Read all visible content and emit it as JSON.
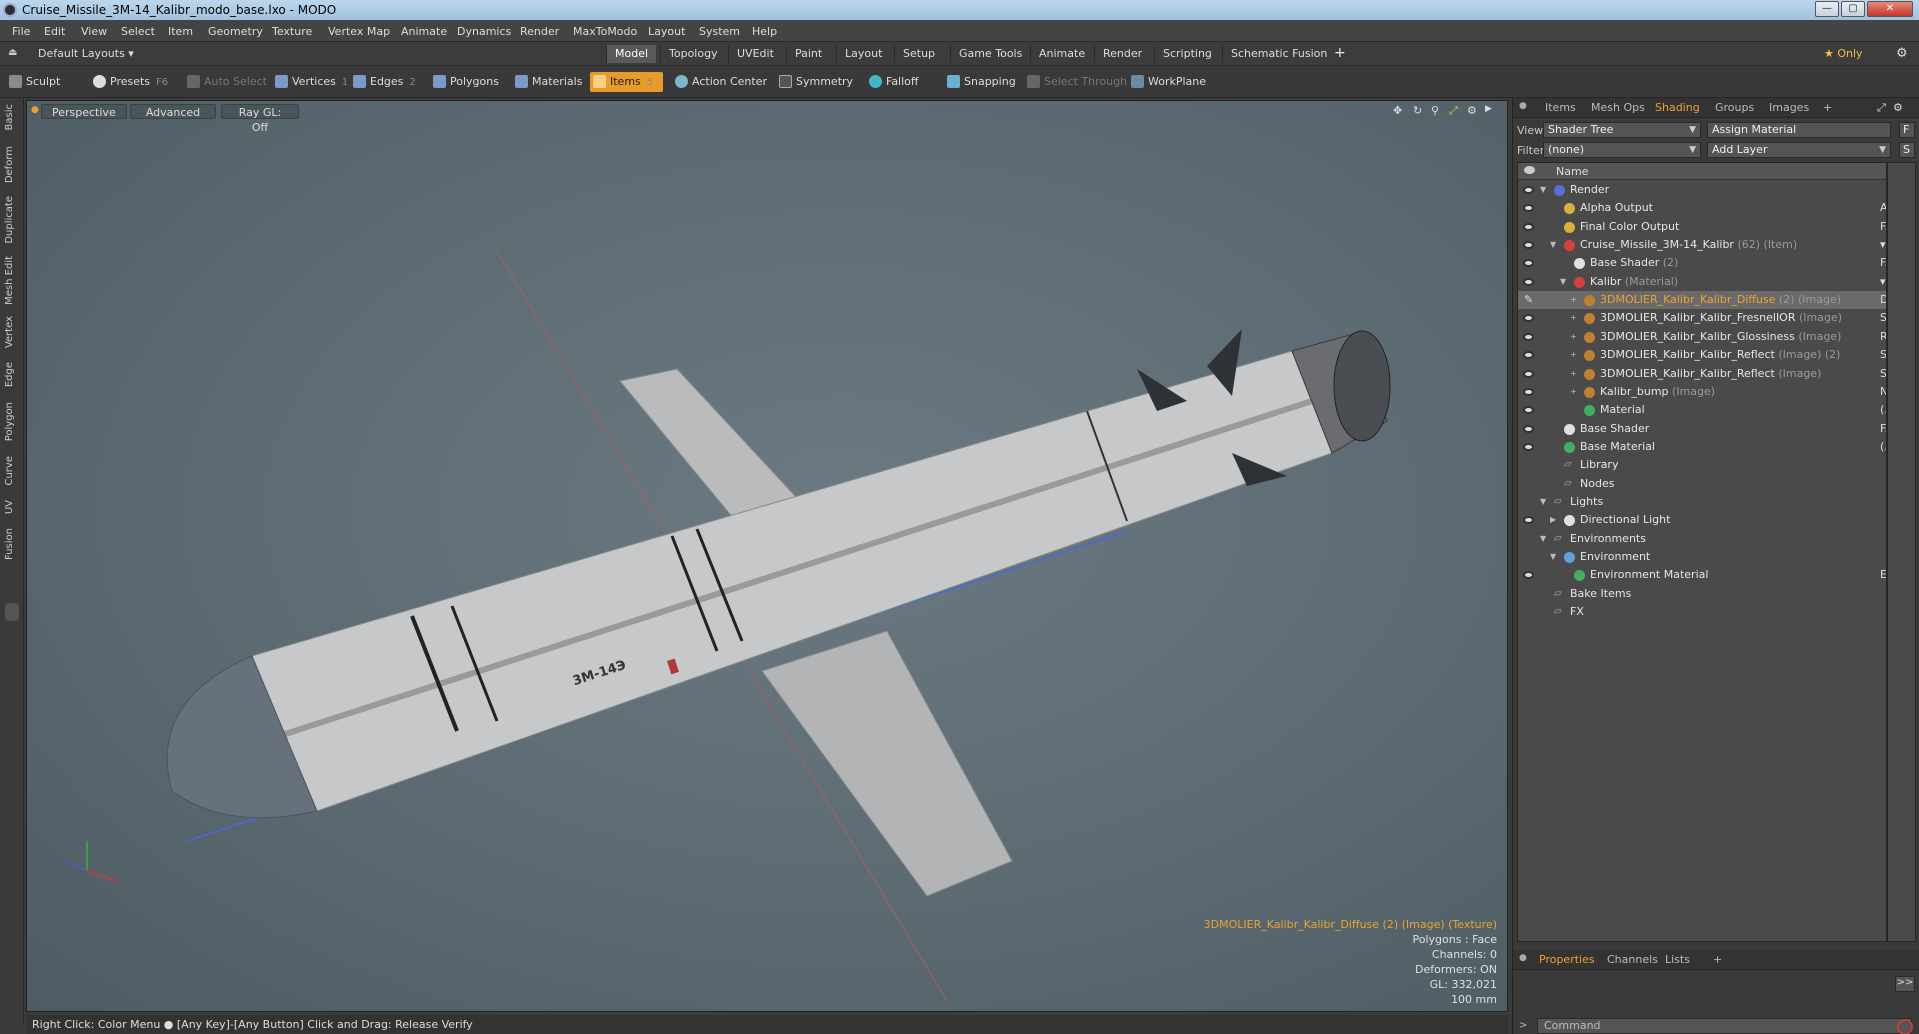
{
  "window": {
    "title": "Cruise_Missile_3M-14_Kalibr_modo_base.lxo - MODO",
    "min": "—",
    "max": "▢",
    "close": "✕"
  },
  "menu": [
    "File",
    "Edit",
    "View",
    "Select",
    "Item",
    "Geometry",
    "Texture",
    "Vertex Map",
    "Animate",
    "Dynamics",
    "Render",
    "MaxToModo",
    "Layout",
    "System",
    "Help"
  ],
  "layoutbar": {
    "layout_label": "Default Layouts ▾",
    "tabs": [
      "Model",
      "Topology",
      "UVEdit",
      "Paint",
      "Layout",
      "Setup",
      "Game Tools",
      "Animate",
      "Render",
      "Scripting",
      "Schematic Fusion"
    ],
    "active": "Model",
    "add": "+",
    "only": "★ Only",
    "gear": "⚙"
  },
  "toolbar": {
    "sculpt": "Sculpt",
    "presets": "Presets",
    "presets_key": "F6",
    "auto_select": "Auto Select",
    "vertices": "Vertices",
    "vertices_key": "1",
    "edges": "Edges",
    "edges_key": "2",
    "polygons": "Polygons",
    "materials": "Materials",
    "items": "Items",
    "items_key": "5",
    "action_center": "Action Center",
    "symmetry": "Symmetry",
    "falloff": "Falloff",
    "snapping": "Snapping",
    "select_through": "Select Through",
    "workplane": "WorkPlane"
  },
  "left_tabs": [
    "Basic",
    "Deform",
    "Duplicate",
    "Mesh Edit",
    "Vertex",
    "Edge",
    "Polygon",
    "Curve",
    "UV",
    "Fusion"
  ],
  "viewport": {
    "view_mode": "Perspective",
    "shading": "Advanced",
    "raygl": "Ray GL: Off",
    "model_label": "3M-14Э",
    "info": {
      "selection": "3DMOLIER_Kalibr_Kalibr_Diffuse (2) (Image) (Texture)",
      "polygons": "Polygons : Face",
      "channels": "Channels: 0",
      "deformers": "Deformers: ON",
      "gl": "GL: 332,021",
      "scale": "100 mm"
    }
  },
  "status": "Right Click: Color Menu ● [Any Key]-[Any Button] Click and Drag: Release Verify",
  "panel": {
    "tabs": [
      "Items",
      "Mesh Ops",
      "Shading",
      "Groups",
      "Images",
      "+"
    ],
    "active_tab": "Shading",
    "view_label": "View",
    "view_value": "Shader Tree",
    "assign_material": "Assign Material",
    "f_btn": "F",
    "filter_label": "Filter",
    "filter_value": "(none)",
    "add_layer": "Add Layer",
    "s_btn": "S",
    "name_header": "Name",
    "tree": [
      {
        "indent": 0,
        "label": "Render",
        "sub": "",
        "right": "",
        "eye": true,
        "color": "#5a6ed8",
        "tri": "▼"
      },
      {
        "indent": 1,
        "label": "Alpha Output",
        "sub": "",
        "right": "A...",
        "eye": true,
        "color": "#d8b040",
        "tri": ""
      },
      {
        "indent": 1,
        "label": "Final Color Output",
        "sub": "",
        "right": "F...",
        "eye": true,
        "color": "#d8b040",
        "tri": ""
      },
      {
        "indent": 1,
        "label": "Cruise_Missile_3M-14_Kalibr",
        "sub": " (62) (Item)",
        "right": "▾",
        "eye": true,
        "color": "#d84040",
        "tri": "▼"
      },
      {
        "indent": 2,
        "label": "Base Shader",
        "sub": " (2)",
        "right": "F...",
        "eye": true,
        "color": "#e0e0e0",
        "tri": ""
      },
      {
        "indent": 2,
        "label": "Kalibr",
        "sub": " (Material)",
        "right": "▾",
        "eye": true,
        "color": "#d84040",
        "tri": "▼"
      },
      {
        "indent": 3,
        "label": "3DMOLIER_Kalibr_Kalibr_Diffuse",
        "sub": " (2) (Image)",
        "right": "D...",
        "eye": false,
        "color": "#c08030",
        "tri": "+",
        "sel": true
      },
      {
        "indent": 3,
        "label": "3DMOLIER_Kalibr_Kalibr_FresnelIOR",
        "sub": " (Image)",
        "right": "S...",
        "eye": true,
        "color": "#c08030",
        "tri": "+"
      },
      {
        "indent": 3,
        "label": "3DMOLIER_Kalibr_Kalibr_Glossiness",
        "sub": " (Image)",
        "right": "R...",
        "eye": true,
        "color": "#c08030",
        "tri": "+"
      },
      {
        "indent": 3,
        "label": "3DMOLIER_Kalibr_Kalibr_Reflect",
        "sub": " (Image) (2)",
        "right": "S...",
        "eye": true,
        "color": "#c08030",
        "tri": "+"
      },
      {
        "indent": 3,
        "label": "3DMOLIER_Kalibr_Kalibr_Reflect",
        "sub": " (Image)",
        "right": "S...",
        "eye": true,
        "color": "#c08030",
        "tri": "+"
      },
      {
        "indent": 3,
        "label": "Kalibr_bump",
        "sub": " (Image)",
        "right": "N...",
        "eye": true,
        "color": "#c08030",
        "tri": "+"
      },
      {
        "indent": 3,
        "label": "Material",
        "sub": "",
        "right": "(...",
        "eye": true,
        "color": "#40b060",
        "tri": ""
      },
      {
        "indent": 1,
        "label": "Base Shader",
        "sub": "",
        "right": "F...",
        "eye": true,
        "color": "#e0e0e0",
        "tri": ""
      },
      {
        "indent": 1,
        "label": "Base Material",
        "sub": "",
        "right": "(...",
        "eye": true,
        "color": "#40b060",
        "tri": ""
      },
      {
        "indent": 1,
        "label": "Library",
        "sub": "",
        "right": "",
        "eye": false,
        "color": "",
        "tri": ""
      },
      {
        "indent": 1,
        "label": "Nodes",
        "sub": "",
        "right": "",
        "eye": false,
        "color": "",
        "tri": ""
      },
      {
        "indent": 0,
        "label": "Lights",
        "sub": "",
        "right": "",
        "eye": false,
        "color": "",
        "tri": "▼"
      },
      {
        "indent": 1,
        "label": "Directional Light",
        "sub": "",
        "right": "",
        "eye": true,
        "color": "#e0e0e0",
        "tri": "▶"
      },
      {
        "indent": 0,
        "label": "Environments",
        "sub": "",
        "right": "",
        "eye": false,
        "color": "",
        "tri": "▼"
      },
      {
        "indent": 1,
        "label": "Environment",
        "sub": "",
        "right": "",
        "eye": false,
        "color": "#60a0e0",
        "tri": "▼"
      },
      {
        "indent": 2,
        "label": "Environment Material",
        "sub": "",
        "right": "E...",
        "eye": true,
        "color": "#40b060",
        "tri": ""
      },
      {
        "indent": 0,
        "label": "Bake Items",
        "sub": "",
        "right": "",
        "eye": false,
        "color": "",
        "tri": ""
      },
      {
        "indent": 0,
        "label": "FX",
        "sub": "",
        "right": "",
        "eye": false,
        "color": "",
        "tri": ""
      }
    ],
    "bottom_tabs": [
      "Properties",
      "Channels",
      "Lists",
      "+"
    ],
    "bottom_active": "Properties",
    "expand": ">>",
    "command_placeholder": "Command"
  }
}
